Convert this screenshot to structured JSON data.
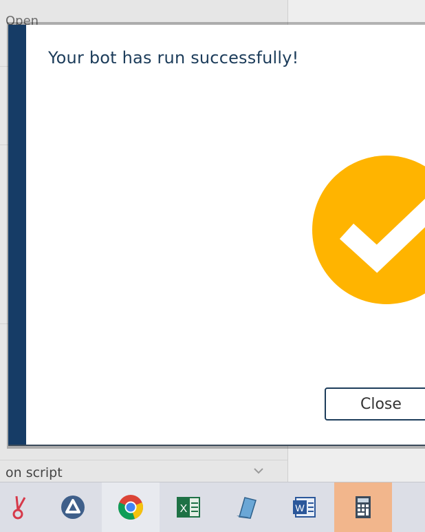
{
  "background": {
    "top_text": "Open",
    "dropdown_label": "on script"
  },
  "modal": {
    "title": "Your bot has run successfully!",
    "close_label": "Close",
    "accent_color": "#163c66",
    "success_color": "#ffb400"
  },
  "taskbar": {
    "items": [
      {
        "icon": "snipping-tool-icon"
      },
      {
        "icon": "app-triangle-icon"
      },
      {
        "icon": "chrome-icon"
      },
      {
        "icon": "excel-icon"
      },
      {
        "icon": "notepad-icon"
      },
      {
        "icon": "word-icon"
      },
      {
        "icon": "calculator-icon"
      }
    ]
  }
}
